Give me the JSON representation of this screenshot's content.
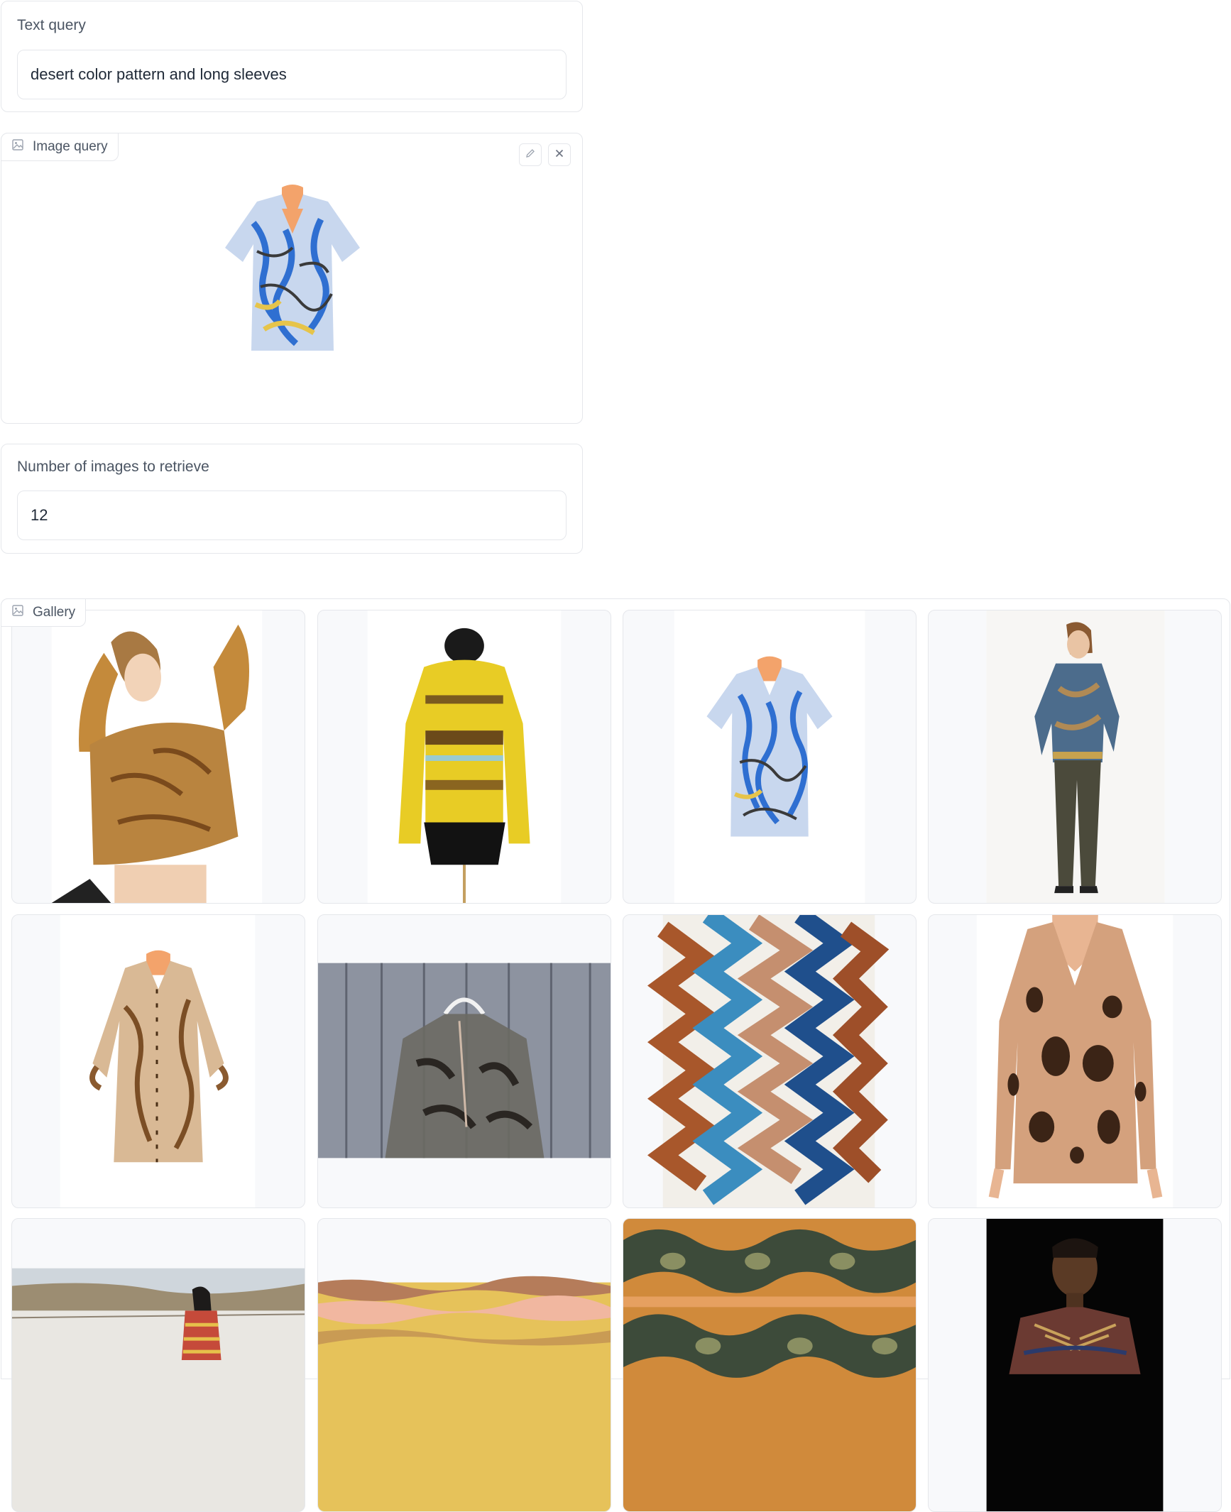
{
  "text_query": {
    "label": "Text query",
    "value": "desert color pattern and long sleeves"
  },
  "image_query": {
    "label": "Image query",
    "edit_icon": "pencil-icon",
    "clear_icon": "close-icon",
    "image_icon": "image-icon",
    "image_subject": "blue and yellow abstract print short-sleeve shirt on mannequin"
  },
  "num_images": {
    "label": "Number of images to retrieve",
    "value": "12"
  },
  "gallery": {
    "label": "Gallery",
    "items": [
      {
        "subject": "woman in golden paisley crop blouse"
      },
      {
        "subject": "yellow striped long-sleeve top on black dress form"
      },
      {
        "subject": "blue and yellow abstract print shirt on mannequin"
      },
      {
        "subject": "woman in blue patterned blouse and olive pants"
      },
      {
        "subject": "beige ruffled print blouse on mannequin"
      },
      {
        "subject": "sheer floral blouse on hanger against wooden wall"
      },
      {
        "subject": "brown and blue zigzag fabric pattern"
      },
      {
        "subject": "animal print long cardigan on mannequin"
      },
      {
        "subject": "woman in desert landscape"
      },
      {
        "subject": "desert-toned wavy stripe pattern"
      },
      {
        "subject": "olive and orange wave pattern"
      },
      {
        "subject": "model in striped top on black background"
      }
    ]
  }
}
